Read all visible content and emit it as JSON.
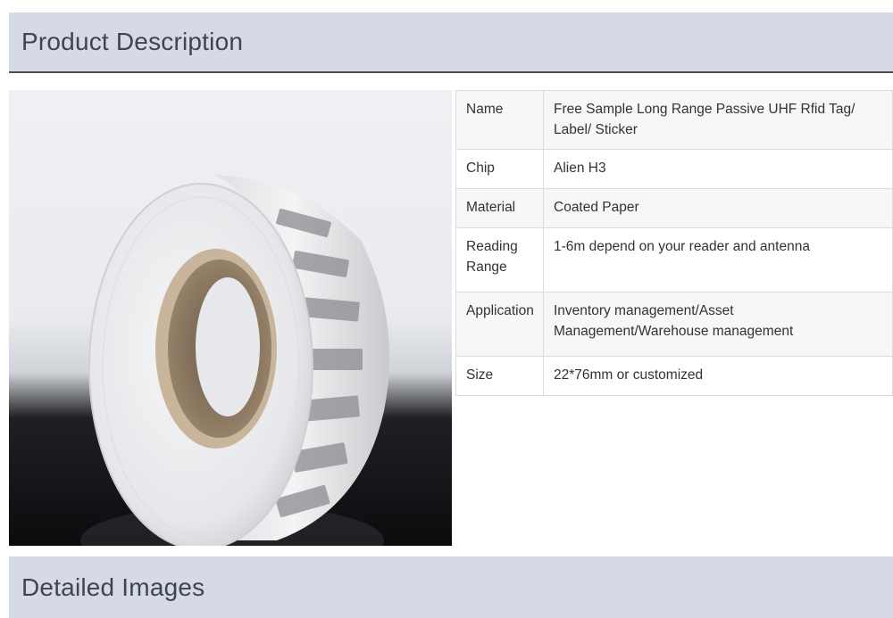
{
  "section_product": {
    "title": "Product Description"
  },
  "section_detailed": {
    "title": "Detailed Images"
  },
  "specs": [
    {
      "key": "Name",
      "value": "Free Sample Long Range Passive UHF Rfid Tag/ Label/ Sticker"
    },
    {
      "key": "Chip",
      "value": "Alien H3"
    },
    {
      "key": "Material",
      "value": "Coated Paper"
    },
    {
      "key": "Reading Range",
      "value": "1-6m depend on your reader and antenna"
    },
    {
      "key": "Application",
      "value": "Inventory management/Asset Management/Warehouse management"
    },
    {
      "key": "Size",
      "value": "22*76mm or customized"
    }
  ]
}
